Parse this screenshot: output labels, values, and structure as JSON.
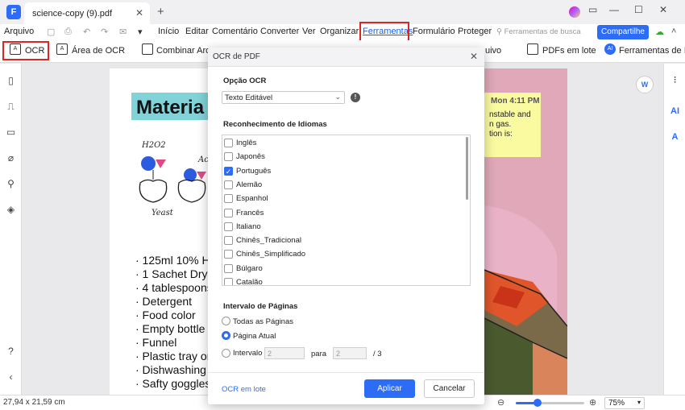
{
  "window": {
    "tab_title": "science-copy (9).pdf",
    "tab_close": "✕",
    "new_tab": "+",
    "controls": {
      "feedback": "▭",
      "minimize": "—",
      "maximize": "☐",
      "close": "✕"
    }
  },
  "menubar": {
    "items": [
      "Arquivo",
      "Início",
      "Editar",
      "Comentário",
      "Converter",
      "Ver",
      "Organizar",
      "Ferramentas",
      "Formulário",
      "Proteger"
    ],
    "active": "Ferramentas",
    "search_tools": "Ferramentas de busca",
    "share_label": "Compartilhe"
  },
  "toolbar": {
    "ocr_label": "OCR",
    "ocr_area_label": "Área de OCR",
    "combine_label": "Combinar Arq",
    "partial_label": "uivo",
    "batch_label": "PDFs em lote",
    "ai_tools_label": "Ferramentas de IA"
  },
  "document": {
    "title": "Materia",
    "handwriting": [
      "H2O2",
      "Active Si",
      "Yeast"
    ],
    "ingredients": [
      "· 125ml 10% H",
      "· 1 Sachet Dry",
      "· 4 tablespoons",
      "· Detergent",
      "· Food color",
      "· Empty bottle",
      "· Funnel",
      "· Plastic tray or",
      "· Dishwashing g",
      "· Safty goggles"
    ],
    "note": {
      "time": "Mon 4:11 PM",
      "lines": [
        "nstable and",
        "n gas.",
        "tion is:"
      ]
    }
  },
  "dialog": {
    "title": "OCR de PDF",
    "ocr_option_label": "Opção OCR",
    "ocr_option_value": "Texto Editável",
    "lang_label": "Reconhecimento de Idiomas",
    "languages": [
      {
        "name": "Inglês",
        "checked": false
      },
      {
        "name": "Japonês",
        "checked": false
      },
      {
        "name": "Português",
        "checked": true
      },
      {
        "name": "Alemão",
        "checked": false
      },
      {
        "name": "Espanhol",
        "checked": false
      },
      {
        "name": "Francês",
        "checked": false
      },
      {
        "name": "Italiano",
        "checked": false
      },
      {
        "name": "Chinês_Tradicional",
        "checked": false
      },
      {
        "name": "Chinês_Simplificado",
        "checked": false
      },
      {
        "name": "Búlgaro",
        "checked": false
      },
      {
        "name": "Catalão",
        "checked": false
      }
    ],
    "page_range_label": "Intervalo de Páginas",
    "opt_all": "Todas as Páginas",
    "opt_current": "Página Atual",
    "opt_range": "Intervalo",
    "range_from": "2",
    "range_to_label": "para",
    "range_to": "2",
    "range_total": "/ 3",
    "selected_range": "current",
    "batch_link": "OCR em lote",
    "apply": "Aplicar",
    "cancel": "Cancelar"
  },
  "statusbar": {
    "dimensions": "27,94 x 21,59 cm",
    "zoom": "75%",
    "zoom_fraction": 0.32
  },
  "colors": {
    "accent": "#2d6cf6",
    "highlight": "#e02424"
  }
}
